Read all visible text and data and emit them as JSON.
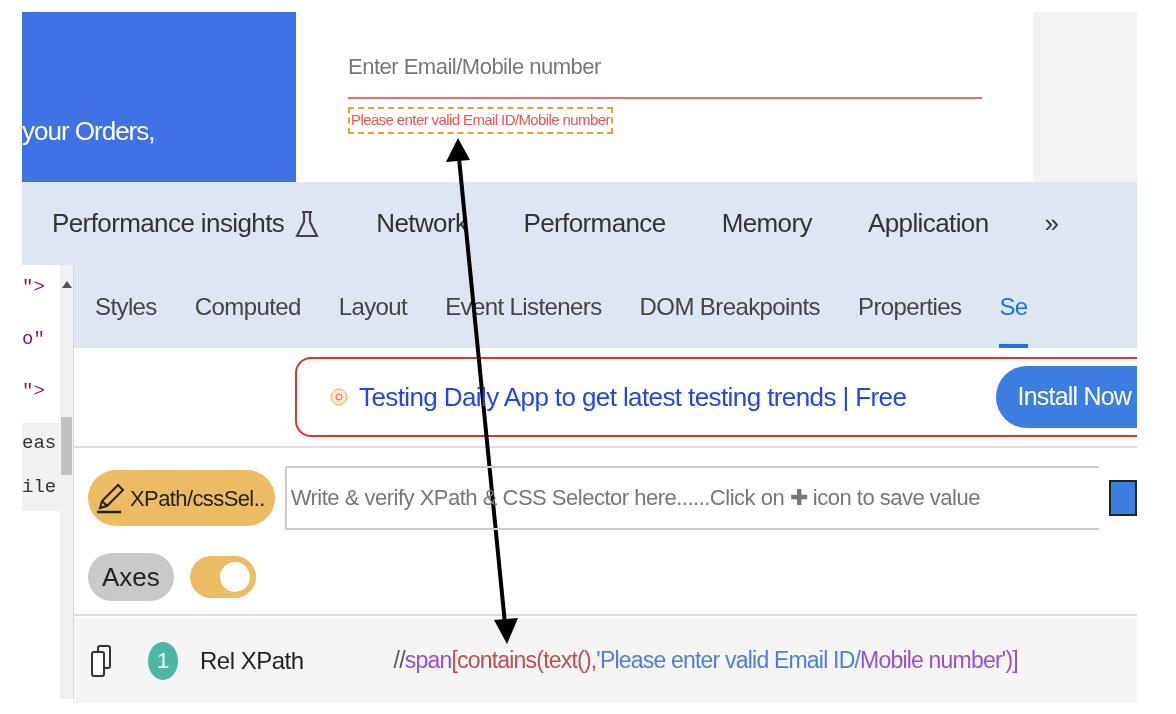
{
  "page": {
    "side_text": "your Orders,",
    "email_field": {
      "placeholder": "Enter Email/Mobile number"
    },
    "error_message": "Please enter valid Email ID/Mobile number"
  },
  "devtools": {
    "tabs": [
      {
        "label": "Performance insights",
        "selected": false
      },
      {
        "label": "Network",
        "selected": false
      },
      {
        "label": "Performance",
        "selected": false
      },
      {
        "label": "Memory",
        "selected": false
      },
      {
        "label": "Application",
        "selected": false
      }
    ],
    "more": "»",
    "code_fragments": [
      "\">",
      "o\"",
      "\">",
      "eas",
      "ile"
    ],
    "sub_tabs": [
      {
        "label": "Styles",
        "selected": false
      },
      {
        "label": "Computed",
        "selected": false
      },
      {
        "label": "Layout",
        "selected": false
      },
      {
        "label": "Event Listeners",
        "selected": false
      },
      {
        "label": "DOM Breakpoints",
        "selected": false
      },
      {
        "label": "Properties",
        "selected": false
      },
      {
        "label": "Se",
        "selected": true
      }
    ],
    "banner": {
      "text": "Testing Daily App to get latest testing trends | Free",
      "button": "Install Now"
    },
    "selector": {
      "mode_button": "XPath/cssSel..",
      "placeholder": "Write & verify XPath & CSS Selector here......Click on ✚ icon to save value",
      "axes_button": "Axes",
      "toggle_on": true
    },
    "result": {
      "count": "1",
      "label": "Rel XPath",
      "parts": [
        {
          "text": "//",
          "color": "#555555"
        },
        {
          "text": "span",
          "color": "#9b4fd6"
        },
        {
          "text": "[contains(text(),",
          "color": "#c0504d"
        },
        {
          "text": "'Please enter valid Email ID/",
          "color": "#4a7fe0"
        },
        {
          "text": "Mobile number')]",
          "color": "#9b4fd6"
        }
      ]
    }
  }
}
